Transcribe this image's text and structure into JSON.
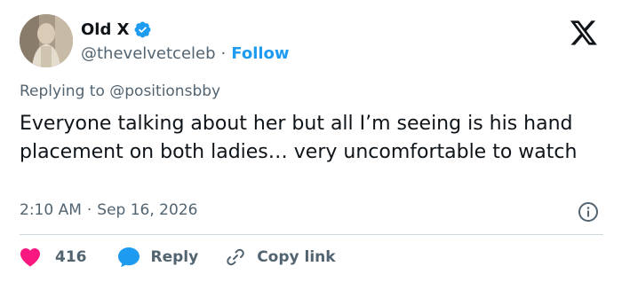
{
  "author": {
    "display_name": "Old X",
    "handle": "@thevelvetceleb",
    "separator": "·",
    "follow_label": "Follow",
    "verified_color": "#1d9bf0"
  },
  "reply": {
    "prefix": "Replying to",
    "mention": "@positionsbby"
  },
  "tweet": {
    "text": "Everyone talking about her but all I’m seeing is his hand placement on both ladies… very uncomfortable to watch",
    "time": "2:10 AM",
    "separator": "·",
    "date": "Sep 16, 2026"
  },
  "actions": {
    "like_count": "416",
    "reply_label": "Reply",
    "copy_label": "Copy link"
  },
  "icons": {
    "brand": "x-logo-icon",
    "verified": "verified-badge-icon",
    "info": "info-icon",
    "like": "heart-icon",
    "reply": "speech-bubble-icon",
    "copy": "link-icon"
  },
  "colors": {
    "accent": "#1d9bf0",
    "like": "#f91880",
    "text": "#0f1419",
    "muted": "#536471"
  }
}
